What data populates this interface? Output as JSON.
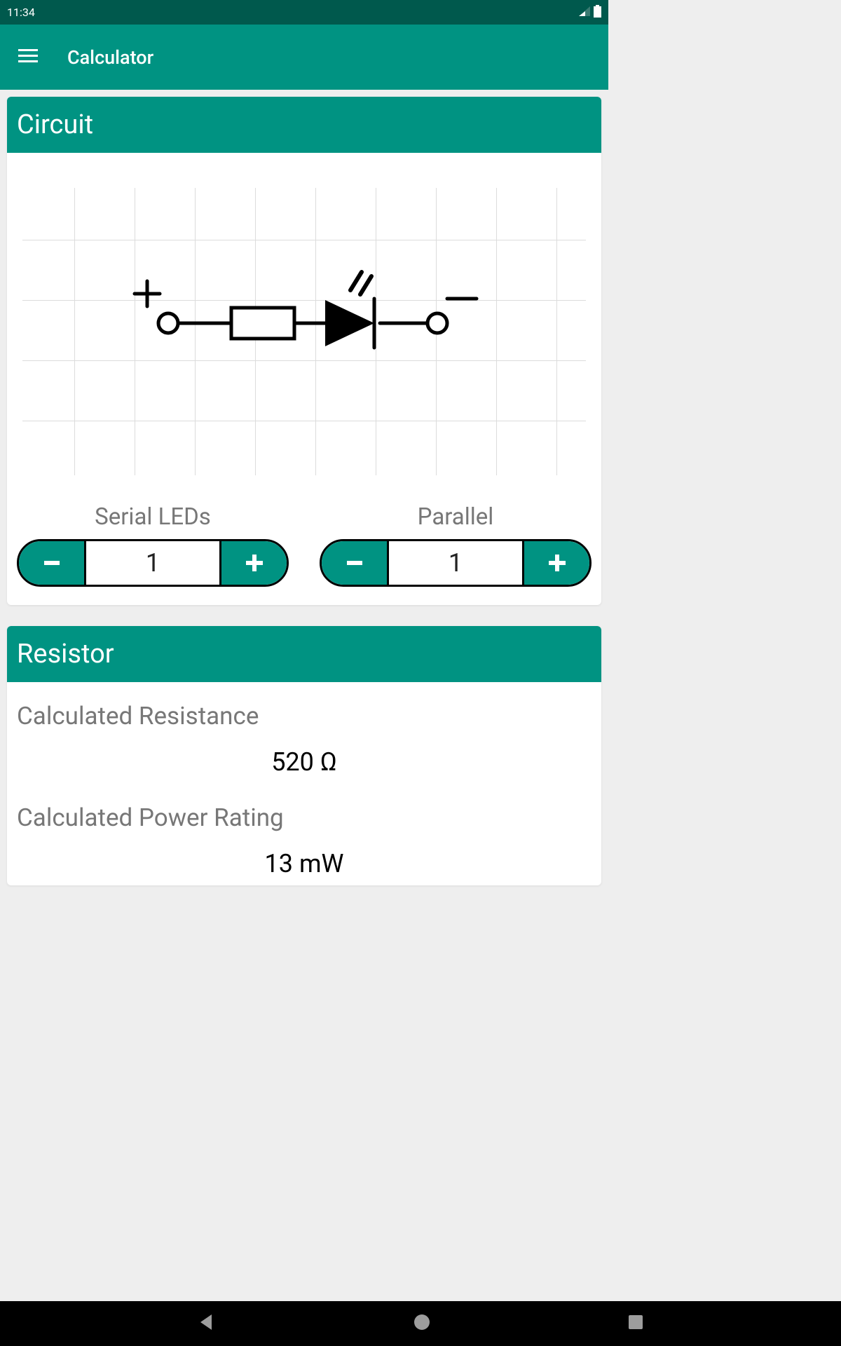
{
  "status": {
    "time": "11:34"
  },
  "header": {
    "title": "Calculator"
  },
  "circuit": {
    "card_title": "Circuit",
    "serial": {
      "label": "Serial LEDs",
      "value": "1"
    },
    "parallel": {
      "label": "Parallel",
      "value": "1"
    }
  },
  "resistor": {
    "card_title": "Resistor",
    "resistance": {
      "label": "Calculated Resistance",
      "value": "520 Ω"
    },
    "power": {
      "label": "Calculated Power Rating",
      "value": "13 mW"
    }
  },
  "icons": {
    "menu": "menu-icon",
    "signal": "signal-icon",
    "battery": "battery-icon",
    "back": "back-icon",
    "home": "home-icon",
    "recent": "recent-icon"
  }
}
